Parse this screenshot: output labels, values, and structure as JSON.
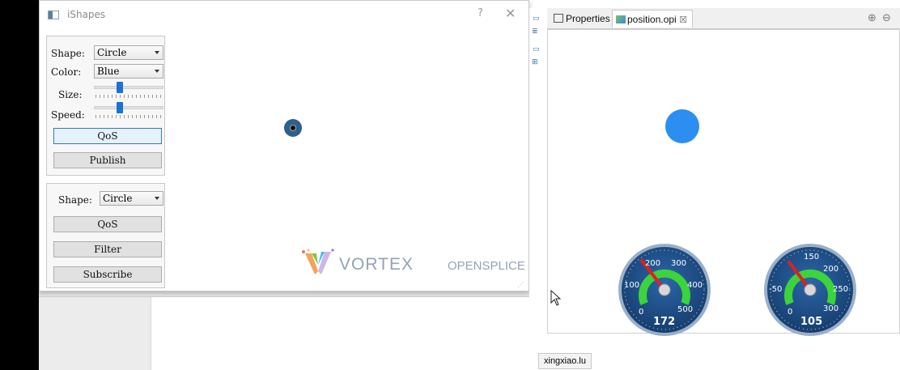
{
  "window": {
    "title": "iShapes",
    "help_glyph": "?",
    "close_glyph": "✕"
  },
  "publisher": {
    "shape_label": "Shape:",
    "shape_value": "Circle",
    "color_label": "Color:",
    "color_value": "Blue",
    "size_label": "Size:",
    "speed_label": "Speed:",
    "qos_label": "QoS",
    "publish_label": "Publish"
  },
  "subscriber": {
    "shape_label": "Shape:",
    "shape_value": "Circle",
    "qos_label": "QoS",
    "filter_label": "Filter",
    "subscribe_label": "Subscribe"
  },
  "branding": {
    "vortex": "VORTEX",
    "opensplice": "OPENSPLICE"
  },
  "editor": {
    "tabs": [
      {
        "label": "Properties"
      },
      {
        "label": "position.opi",
        "close": "☒"
      }
    ],
    "zoom_in": "⊕",
    "zoom_out": "⊖"
  },
  "gauges": [
    {
      "ticks": [
        "0",
        "100",
        "200",
        "300",
        "400",
        "500"
      ],
      "value": "172"
    },
    {
      "ticks": [
        "0",
        "-50",
        "150",
        "200",
        "250",
        "300"
      ],
      "value": "105"
    }
  ],
  "status": {
    "user": "xingxiao.lu"
  },
  "colors": {
    "blue_shape": "#2b8ef0",
    "dark_shape": "#2f5f8a",
    "gauge_face": "#1f4f88",
    "gauge_arc": "#3cd33c",
    "needle": "#e02020"
  }
}
